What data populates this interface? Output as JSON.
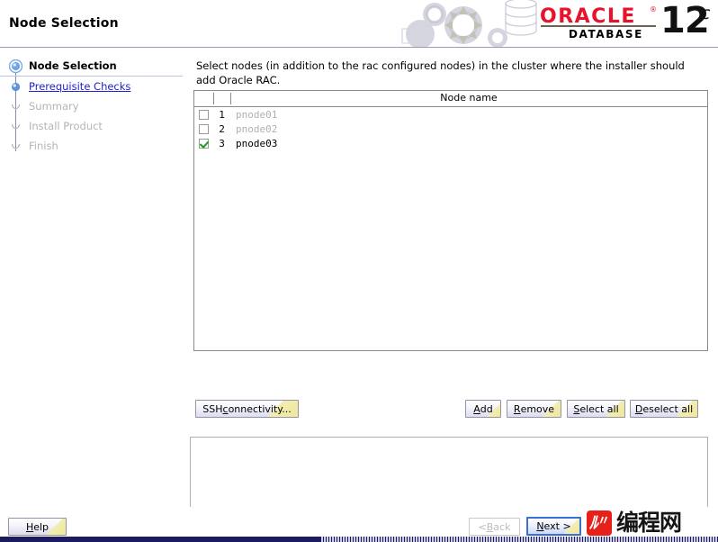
{
  "header": {
    "title": "Node Selection",
    "logo": {
      "brand": "ORACLE",
      "trademark": "®",
      "product": "DATABASE",
      "version": "12",
      "edition": "c"
    },
    "art_icon": "gears-database-graphic"
  },
  "sidebar": {
    "items": [
      {
        "label": "Node Selection",
        "state": "active",
        "icon": "step-current-icon"
      },
      {
        "label": "Prerequisite Checks",
        "state": "link",
        "icon": "step-done-icon"
      },
      {
        "label": "Summary",
        "state": "disabled",
        "icon": "step-pending-icon"
      },
      {
        "label": "Install Product",
        "state": "disabled",
        "icon": "step-pending-icon"
      },
      {
        "label": "Finish",
        "state": "disabled",
        "icon": "step-pending-icon"
      }
    ]
  },
  "main": {
    "instruction": "Select nodes (in addition to the rac configured nodes) in the cluster where the installer should add Oracle RAC.",
    "table": {
      "column_header": "Node name",
      "rows": [
        {
          "num": "1",
          "name": "pnode01",
          "checked": false,
          "enabled": false
        },
        {
          "num": "2",
          "name": "pnode02",
          "checked": false,
          "enabled": false
        },
        {
          "num": "3",
          "name": "pnode03",
          "checked": true,
          "enabled": true
        }
      ]
    },
    "buttons": {
      "ssh": {
        "pre": "SSH ",
        "mnemonic": "c",
        "post": "onnectivity..."
      },
      "add": {
        "pre": "",
        "mnemonic": "A",
        "post": "dd"
      },
      "remove": {
        "pre": "",
        "mnemonic": "R",
        "post": "emove"
      },
      "select_all": {
        "pre": "",
        "mnemonic": "S",
        "post": "elect all"
      },
      "deselect_all": {
        "pre": "",
        "mnemonic": "D",
        "post": "eselect all"
      }
    }
  },
  "footer": {
    "help": {
      "pre": "",
      "mnemonic": "H",
      "post": "elp"
    },
    "back": {
      "pre": "< ",
      "mnemonic": "B",
      "post": "ack"
    },
    "next": {
      "pre": "",
      "mnemonic": "N",
      "post": "ext >"
    },
    "watermark": "编程网"
  },
  "colors": {
    "oracle_red": "#e8132b",
    "link_blue": "#2222cc",
    "check_green": "#1a9a1a",
    "focus_blue": "#3a6fd8",
    "bottom_bar": "#1b1b5e"
  }
}
